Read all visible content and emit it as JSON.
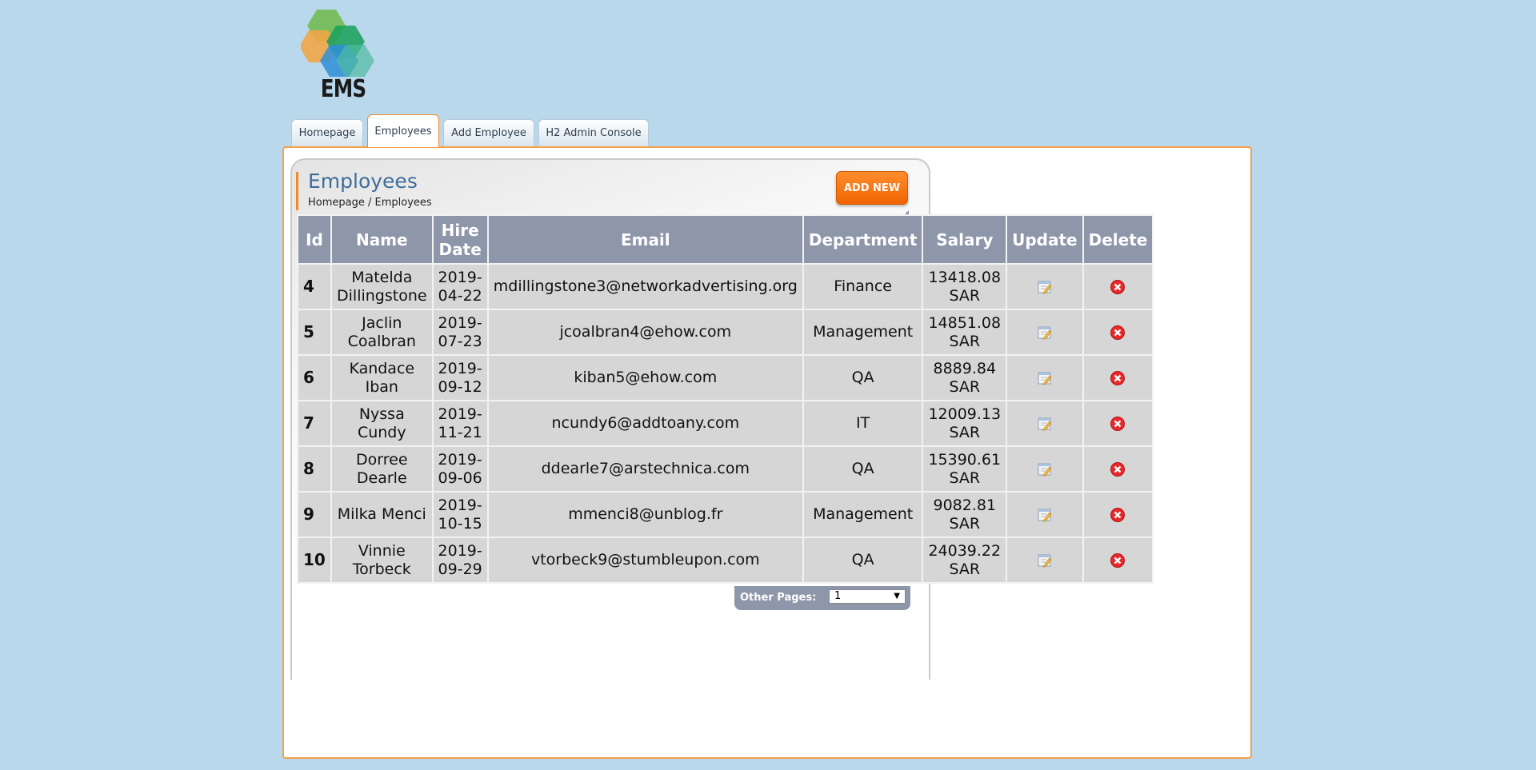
{
  "app": {
    "logo_text": "EMS"
  },
  "tabs": [
    {
      "label": "Homepage",
      "active": false
    },
    {
      "label": "Employees",
      "active": true
    },
    {
      "label": "Add Employee",
      "active": false
    },
    {
      "label": "H2 Admin Console",
      "active": false
    }
  ],
  "page": {
    "title": "Employees",
    "breadcrumb": [
      "Homepage",
      "Employees"
    ],
    "breadcrumb_sep": " / ",
    "add_new_label": "ADD NEW"
  },
  "table": {
    "headers": [
      "Id",
      "Name",
      "Hire Date",
      "Email",
      "Department",
      "Salary",
      "Update",
      "Delete"
    ],
    "rows": [
      {
        "id": "4",
        "name": "Matelda Dillingstone",
        "hire_date": "2019-04-22",
        "email": "mdillingstone3@networkadvertising.org",
        "department": "Finance",
        "salary": "13418.08 SAR"
      },
      {
        "id": "5",
        "name": "Jaclin Coalbran",
        "hire_date": "2019-07-23",
        "email": "jcoalbran4@ehow.com",
        "department": "Management",
        "salary": "14851.08 SAR"
      },
      {
        "id": "6",
        "name": "Kandace Iban",
        "hire_date": "2019-09-12",
        "email": "kiban5@ehow.com",
        "department": "QA",
        "salary": "8889.84 SAR"
      },
      {
        "id": "7",
        "name": "Nyssa Cundy",
        "hire_date": "2019-11-21",
        "email": "ncundy6@addtoany.com",
        "department": "IT",
        "salary": "12009.13 SAR"
      },
      {
        "id": "8",
        "name": "Dorree Dearle",
        "hire_date": "2019-09-06",
        "email": "ddearle7@arstechnica.com",
        "department": "QA",
        "salary": "15390.61 SAR"
      },
      {
        "id": "9",
        "name": "Milka Menci",
        "hire_date": "2019-10-15",
        "email": "mmenci8@unblog.fr",
        "department": "Management",
        "salary": "9082.81 SAR"
      },
      {
        "id": "10",
        "name": "Vinnie Torbeck",
        "hire_date": "2019-09-29",
        "email": "vtorbeck9@stumbleupon.com",
        "department": "QA",
        "salary": "24039.22 SAR"
      }
    ],
    "update_icon": "edit-icon",
    "delete_icon": "delete-icon"
  },
  "pager": {
    "label": "Other Pages:",
    "selected": "1"
  },
  "colors": {
    "background": "#bad8ec",
    "accent": "#f08a24",
    "header": "#8e96aa",
    "title": "#3f6d9a"
  }
}
